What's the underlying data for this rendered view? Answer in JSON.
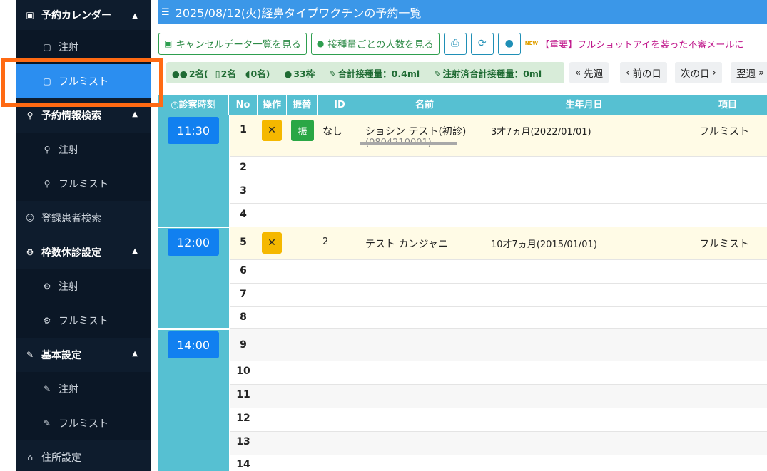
{
  "sidebar": {
    "sections": [
      {
        "label": "予約カレンダー",
        "icon": "calendar-icon"
      },
      {
        "label": "予約情報検索",
        "icon": "search-icon"
      },
      {
        "label": "登録患者検索",
        "icon": "users-icon"
      },
      {
        "label": "枠数休診設定",
        "icon": "gear-icon"
      },
      {
        "label": "基本設定",
        "icon": "wrench-icon"
      },
      {
        "label": "住所設定",
        "icon": "home-icon"
      }
    ],
    "calendar_items": [
      "注射",
      "フルミスト"
    ],
    "search_items": [
      "注射",
      "フルミスト"
    ],
    "frame_items": [
      "注射",
      "フルミスト"
    ],
    "basic_items": [
      "注射",
      "フルミスト"
    ]
  },
  "header": {
    "title": "2025/08/12(火)経鼻タイプワクチンの予約一覧"
  },
  "toolbar": {
    "cancel_list_label": "キャンセルデータ一覧を見る",
    "per_dose_label": "接種量ごとの人数を見る",
    "new_tag": "NEW",
    "notice": "【重要】フルショットアイを装った不審メールに"
  },
  "stats": {
    "people": "2名(",
    "phone": "2名",
    "pc": "0名)",
    "slots": "33枠",
    "total_dose": "合計接種量：0.4ml",
    "done_dose": "注射済合計接種量：0ml"
  },
  "nav": {
    "prev_week": "先週",
    "prev_day": "前の日",
    "next_day": "次の日",
    "next_week": "翌週"
  },
  "table": {
    "headers": {
      "time": "診察時刻",
      "no": "No",
      "op": "操作",
      "transfer": "振替",
      "id": "ID",
      "name": "名前",
      "birth": "生年月日",
      "item": "項目"
    },
    "times": [
      "11:30",
      "12:00",
      "14:00"
    ],
    "cancel_symbol": "✕",
    "transfer_label": "振",
    "rows": [
      {
        "no": "1",
        "id": "なし",
        "name": "ショシン テスト(初診)",
        "sub": "(0804210001)",
        "birth": "3才7ヵ月(2022/01/01)",
        "item": "フルミスト"
      },
      {
        "no": "2"
      },
      {
        "no": "3"
      },
      {
        "no": "4"
      },
      {
        "no": "5",
        "id": "2",
        "name": "テスト カンジャニ",
        "birth": "10才7ヵ月(2015/01/01)",
        "item": "フルミスト"
      },
      {
        "no": "6"
      },
      {
        "no": "7"
      },
      {
        "no": "8"
      },
      {
        "no": "9"
      },
      {
        "no": "10"
      },
      {
        "no": "11"
      },
      {
        "no": "12"
      },
      {
        "no": "13"
      },
      {
        "no": "14"
      }
    ]
  },
  "colors": {
    "sidebar_bg": "#0b1726",
    "active": "#2b8ef0",
    "highlight": "#ff6a13",
    "header": "#3b97e8",
    "table_header": "#56c0d2"
  }
}
